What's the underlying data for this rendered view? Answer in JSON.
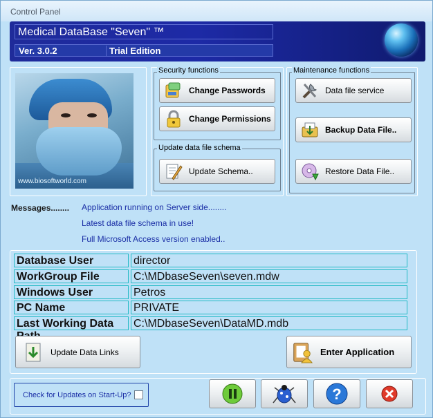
{
  "window": {
    "title": "Control Panel"
  },
  "banner": {
    "app_title": "Medical DataBase \"Seven\" ™",
    "version": "Ver. 3.0.2",
    "edition": "Trial Edition"
  },
  "photo": {
    "caption": "www.biosoftworld.com"
  },
  "security": {
    "title": "Security functions",
    "change_passwords": "Change Passwords",
    "change_permissions": "Change Permissions"
  },
  "schema": {
    "title": "Update data file schema",
    "update_schema": "Update Schema.."
  },
  "maintenance": {
    "title": "Maintenance functions",
    "data_file_service": "Data file service",
    "backup": "Backup Data File..",
    "restore": "Restore Data File.."
  },
  "messages": {
    "label": "Messages........",
    "lines": [
      "Application running on Server side........",
      "Latest data file schema in use!",
      "Full Microsoft Access version enabled.."
    ]
  },
  "info": {
    "rows": [
      {
        "key": "Database User",
        "value": "director"
      },
      {
        "key": "WorkGroup File",
        "value": "C:\\MDbaseSeven\\seven.mdw"
      },
      {
        "key": "Windows User",
        "value": "Petros"
      },
      {
        "key": "PC Name",
        "value": "PRIVATE"
      },
      {
        "key": "Last Working Data Path",
        "value": "C:\\MDbaseSeven\\DataMD.mdb"
      }
    ],
    "update_links": "Update Data Links",
    "enter_app": "Enter Application"
  },
  "bottom": {
    "check_label": "Check for Updates on Start-Up?",
    "check_value": false
  },
  "colors": {
    "background": "#bfe1f7",
    "banner": "#1f2b9a",
    "message_text": "#1b2fa6",
    "field_border": "#1fb9c4"
  }
}
